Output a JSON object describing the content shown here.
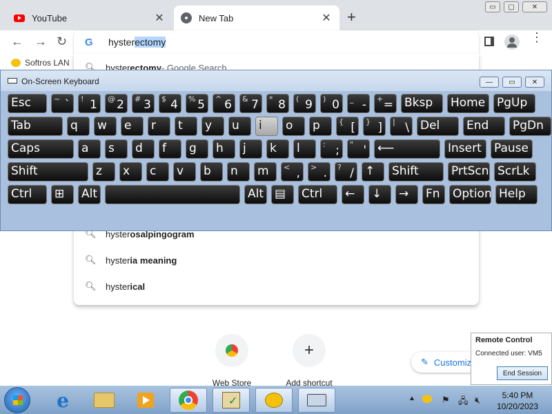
{
  "browser": {
    "tabs": [
      {
        "title": "YouTube",
        "close": "✕"
      },
      {
        "title": "New Tab",
        "close": "✕"
      }
    ],
    "new_tab_symbol": "+",
    "window_controls": {
      "minimize": "▭",
      "maximize": "▢",
      "close": "✕"
    },
    "omnibox": {
      "typed": "hyster",
      "autocomplete": "ectomy"
    },
    "bookmark": {
      "label": "Softros LAN"
    },
    "suggestions": [
      {
        "prefix": "hyster",
        "completion": "ectomy",
        "suffix": " - Google Search"
      },
      {
        "prefix": "hyster",
        "completion": "osalpingogram"
      },
      {
        "prefix": "hyster",
        "completion": "ia meaning"
      },
      {
        "prefix": "hyster",
        "completion": "ical"
      }
    ],
    "shortcuts": [
      {
        "label": "Web Store"
      },
      {
        "label": "Add shortcut",
        "icon": "+"
      }
    ],
    "customize_label": "Customize Chrome"
  },
  "remote_control": {
    "title": "Remote Control",
    "connected_user": "Connected user: VM5",
    "end_button": "End Session"
  },
  "osk": {
    "title": "On-Screen Keyboard",
    "controls": {
      "minimize": "—",
      "maximize": "▭",
      "close": "✕"
    },
    "rows": [
      [
        {
          "m": "Esc"
        },
        {
          "s": "~",
          "l": "`"
        },
        {
          "s": "!",
          "l": "1"
        },
        {
          "s": "@",
          "l": "2"
        },
        {
          "s": "#",
          "l": "3"
        },
        {
          "s": "$",
          "l": "4"
        },
        {
          "s": "%",
          "l": "5"
        },
        {
          "s": "^",
          "l": "6"
        },
        {
          "s": "&",
          "l": "7"
        },
        {
          "s": "*",
          "l": "8"
        },
        {
          "s": "(",
          "l": "9"
        },
        {
          "s": ")",
          "l": "0"
        },
        {
          "s": "_",
          "l": "-"
        },
        {
          "s": "+",
          "l": "="
        },
        {
          "m": "Bksp"
        },
        {
          "m": "Home"
        },
        {
          "m": "PgUp"
        }
      ],
      [
        {
          "m": "Tab"
        },
        {
          "m": "q"
        },
        {
          "m": "w"
        },
        {
          "m": "e"
        },
        {
          "m": "r"
        },
        {
          "m": "t"
        },
        {
          "m": "y"
        },
        {
          "m": "u"
        },
        {
          "m": "i"
        },
        {
          "m": "o"
        },
        {
          "m": "p"
        },
        {
          "s": "{",
          "l": "["
        },
        {
          "s": "}",
          "l": "]"
        },
        {
          "s": "|",
          "l": "\\"
        },
        {
          "m": "Del"
        },
        {
          "m": "End"
        },
        {
          "m": "PgDn"
        }
      ],
      [
        {
          "m": "Caps"
        },
        {
          "m": "a"
        },
        {
          "m": "s"
        },
        {
          "m": "d"
        },
        {
          "m": "f"
        },
        {
          "m": "g"
        },
        {
          "m": "h"
        },
        {
          "m": "j"
        },
        {
          "m": "k"
        },
        {
          "m": "l"
        },
        {
          "s": ":",
          "l": ";"
        },
        {
          "s": "\"",
          "l": "'"
        },
        {
          "m": "⟵"
        },
        {
          "m": "Insert"
        },
        {
          "m": "Pause"
        }
      ],
      [
        {
          "m": "Shift"
        },
        {
          "m": "z"
        },
        {
          "m": "x"
        },
        {
          "m": "c"
        },
        {
          "m": "v"
        },
        {
          "m": "b"
        },
        {
          "m": "n"
        },
        {
          "m": "m"
        },
        {
          "s": "<",
          "l": ","
        },
        {
          "s": ">",
          "l": "."
        },
        {
          "s": "?",
          "l": "/"
        },
        {
          "m": "↑"
        },
        {
          "m": "Shift"
        },
        {
          "m": "PrtScn"
        },
        {
          "m": "ScrLk"
        }
      ],
      [
        {
          "m": "Ctrl"
        },
        {
          "m": "⊞"
        },
        {
          "m": "Alt"
        },
        {
          "m": ""
        },
        {
          "m": "Alt"
        },
        {
          "m": "▤"
        },
        {
          "m": "Ctrl"
        },
        {
          "m": "←"
        },
        {
          "m": "↓"
        },
        {
          "m": "→"
        },
        {
          "m": "Fn"
        },
        {
          "m": "Options"
        },
        {
          "m": "Help"
        }
      ]
    ],
    "highlighted_key": "i"
  },
  "taskbar": {
    "time": "5:40 PM",
    "date": "10/20/2023",
    "tray_arrow": "▲"
  }
}
